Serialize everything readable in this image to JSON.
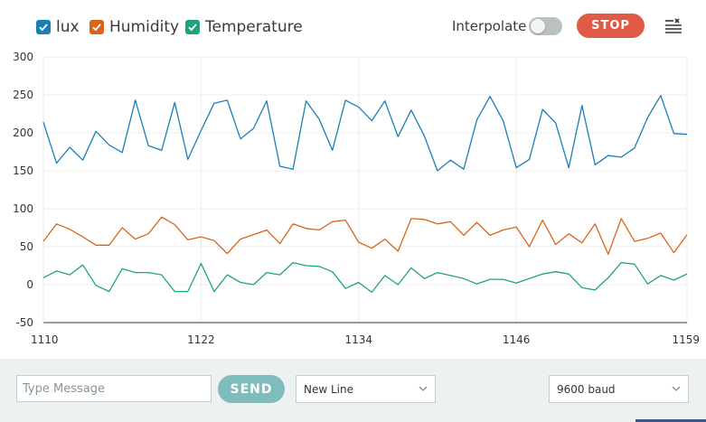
{
  "legend": [
    {
      "label": "lux",
      "color": "#1a7fb5",
      "checked": true
    },
    {
      "label": "Humidity",
      "color": "#d9651b",
      "checked": true
    },
    {
      "label": "Temperature",
      "color": "#1fa37d",
      "checked": true
    }
  ],
  "controls": {
    "interpolate_label": "Interpolate",
    "interpolate_on": false,
    "stop_label": "STOP",
    "menu_icon": "list-settings-icon"
  },
  "bottom": {
    "message_placeholder": "Type Message",
    "send_label": "SEND",
    "line_ending": "New Line",
    "baud": "9600 baud"
  },
  "chart_data": {
    "type": "line",
    "xlim": [
      1110,
      1159
    ],
    "ylim": [
      -50,
      300
    ],
    "x_ticks": [
      "1110",
      "1122",
      "1134",
      "1146",
      "1159"
    ],
    "y_ticks": [
      "300",
      "250",
      "200",
      "150",
      "100",
      "50",
      "0",
      "-50"
    ],
    "grid": true,
    "x_start": 1110,
    "series": [
      {
        "name": "lux",
        "color": "#1a7fb5",
        "values": [
          214,
          160,
          181,
          164,
          202,
          184,
          174,
          243,
          183,
          177,
          240,
          165,
          203,
          239,
          243,
          192,
          206,
          242,
          156,
          152,
          242,
          218,
          177,
          243,
          234,
          216,
          242,
          195,
          230,
          196,
          150,
          164,
          152,
          217,
          248,
          216,
          154,
          165,
          231,
          213,
          154,
          236,
          158,
          170,
          168,
          180,
          220,
          249,
          199,
          198
        ]
      },
      {
        "name": "Humidity",
        "color": "#d9651b",
        "values": [
          57,
          80,
          73,
          63,
          52,
          52,
          75,
          60,
          67,
          89,
          79,
          59,
          63,
          58,
          41,
          60,
          66,
          72,
          54,
          80,
          74,
          72,
          83,
          85,
          56,
          48,
          60,
          44,
          87,
          86,
          80,
          83,
          65,
          82,
          65,
          72,
          76,
          50,
          85,
          53,
          67,
          55,
          80,
          40,
          87,
          57,
          61,
          68,
          42,
          66
        ]
      },
      {
        "name": "Temperature",
        "color": "#1fa37d",
        "values": [
          9,
          18,
          13,
          26,
          -1,
          -9,
          21,
          16,
          16,
          13,
          -9,
          -9,
          28,
          -9,
          13,
          3,
          0,
          16,
          13,
          29,
          25,
          24,
          17,
          -5,
          3,
          -10,
          12,
          0,
          22,
          8,
          16,
          12,
          8,
          1,
          7,
          7,
          2,
          8,
          14,
          17,
          14,
          -4,
          -7,
          9,
          29,
          27,
          1,
          12,
          6,
          14
        ]
      }
    ]
  }
}
